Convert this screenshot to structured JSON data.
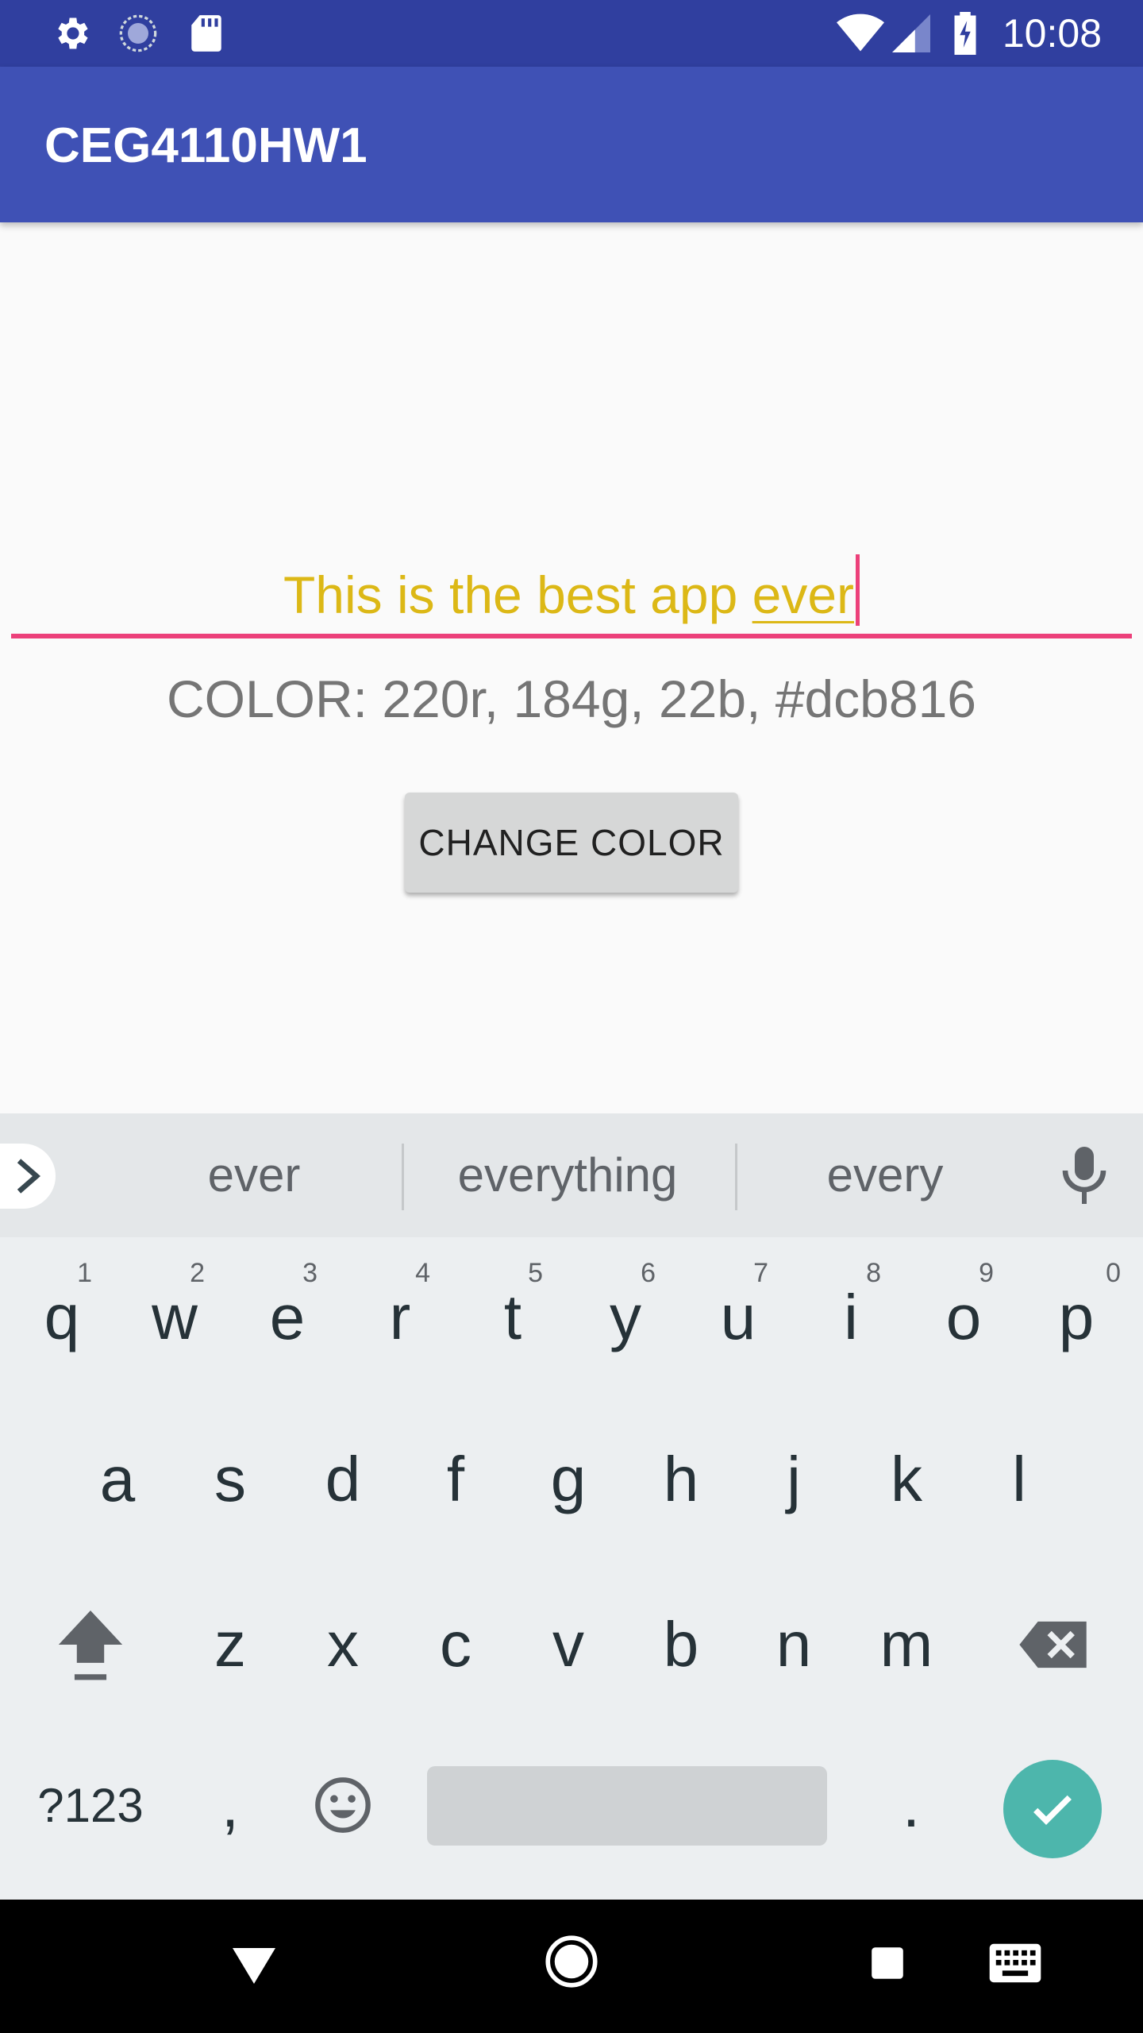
{
  "status_bar": {
    "time": "10:08",
    "icons": [
      "gear-icon",
      "sync-icon",
      "sd-card-icon",
      "wifi-icon",
      "cell-signal-icon",
      "battery-charging-icon"
    ]
  },
  "app_bar": {
    "title": "CEG4110HW1",
    "color": "#3f51b5"
  },
  "main": {
    "edit_text": {
      "value_prefix": "This is the best app ",
      "value_composing": "ever",
      "text_color": "#dcb816",
      "accent": "#ec407a"
    },
    "color_info": "COLOR: 220r, 184g, 22b, #dcb816",
    "change_button_label": "CHANGE COLOR"
  },
  "keyboard": {
    "suggestions": [
      "ever",
      "everything",
      "every"
    ],
    "row1": [
      {
        "key": "q",
        "hint": "1"
      },
      {
        "key": "w",
        "hint": "2"
      },
      {
        "key": "e",
        "hint": "3"
      },
      {
        "key": "r",
        "hint": "4"
      },
      {
        "key": "t",
        "hint": "5"
      },
      {
        "key": "y",
        "hint": "6"
      },
      {
        "key": "u",
        "hint": "7"
      },
      {
        "key": "i",
        "hint": "8"
      },
      {
        "key": "o",
        "hint": "9"
      },
      {
        "key": "p",
        "hint": "0"
      }
    ],
    "row2": [
      "a",
      "s",
      "d",
      "f",
      "g",
      "h",
      "j",
      "k",
      "l"
    ],
    "row3": [
      "z",
      "x",
      "c",
      "v",
      "b",
      "n",
      "m"
    ],
    "row4": {
      "symbols": "?123",
      "comma": ",",
      "period": "."
    },
    "enter_color": "#4db6ac"
  },
  "nav_bar": {
    "buttons": [
      "back-icon",
      "home-icon",
      "recents-icon",
      "keyboard-switch-icon"
    ]
  }
}
